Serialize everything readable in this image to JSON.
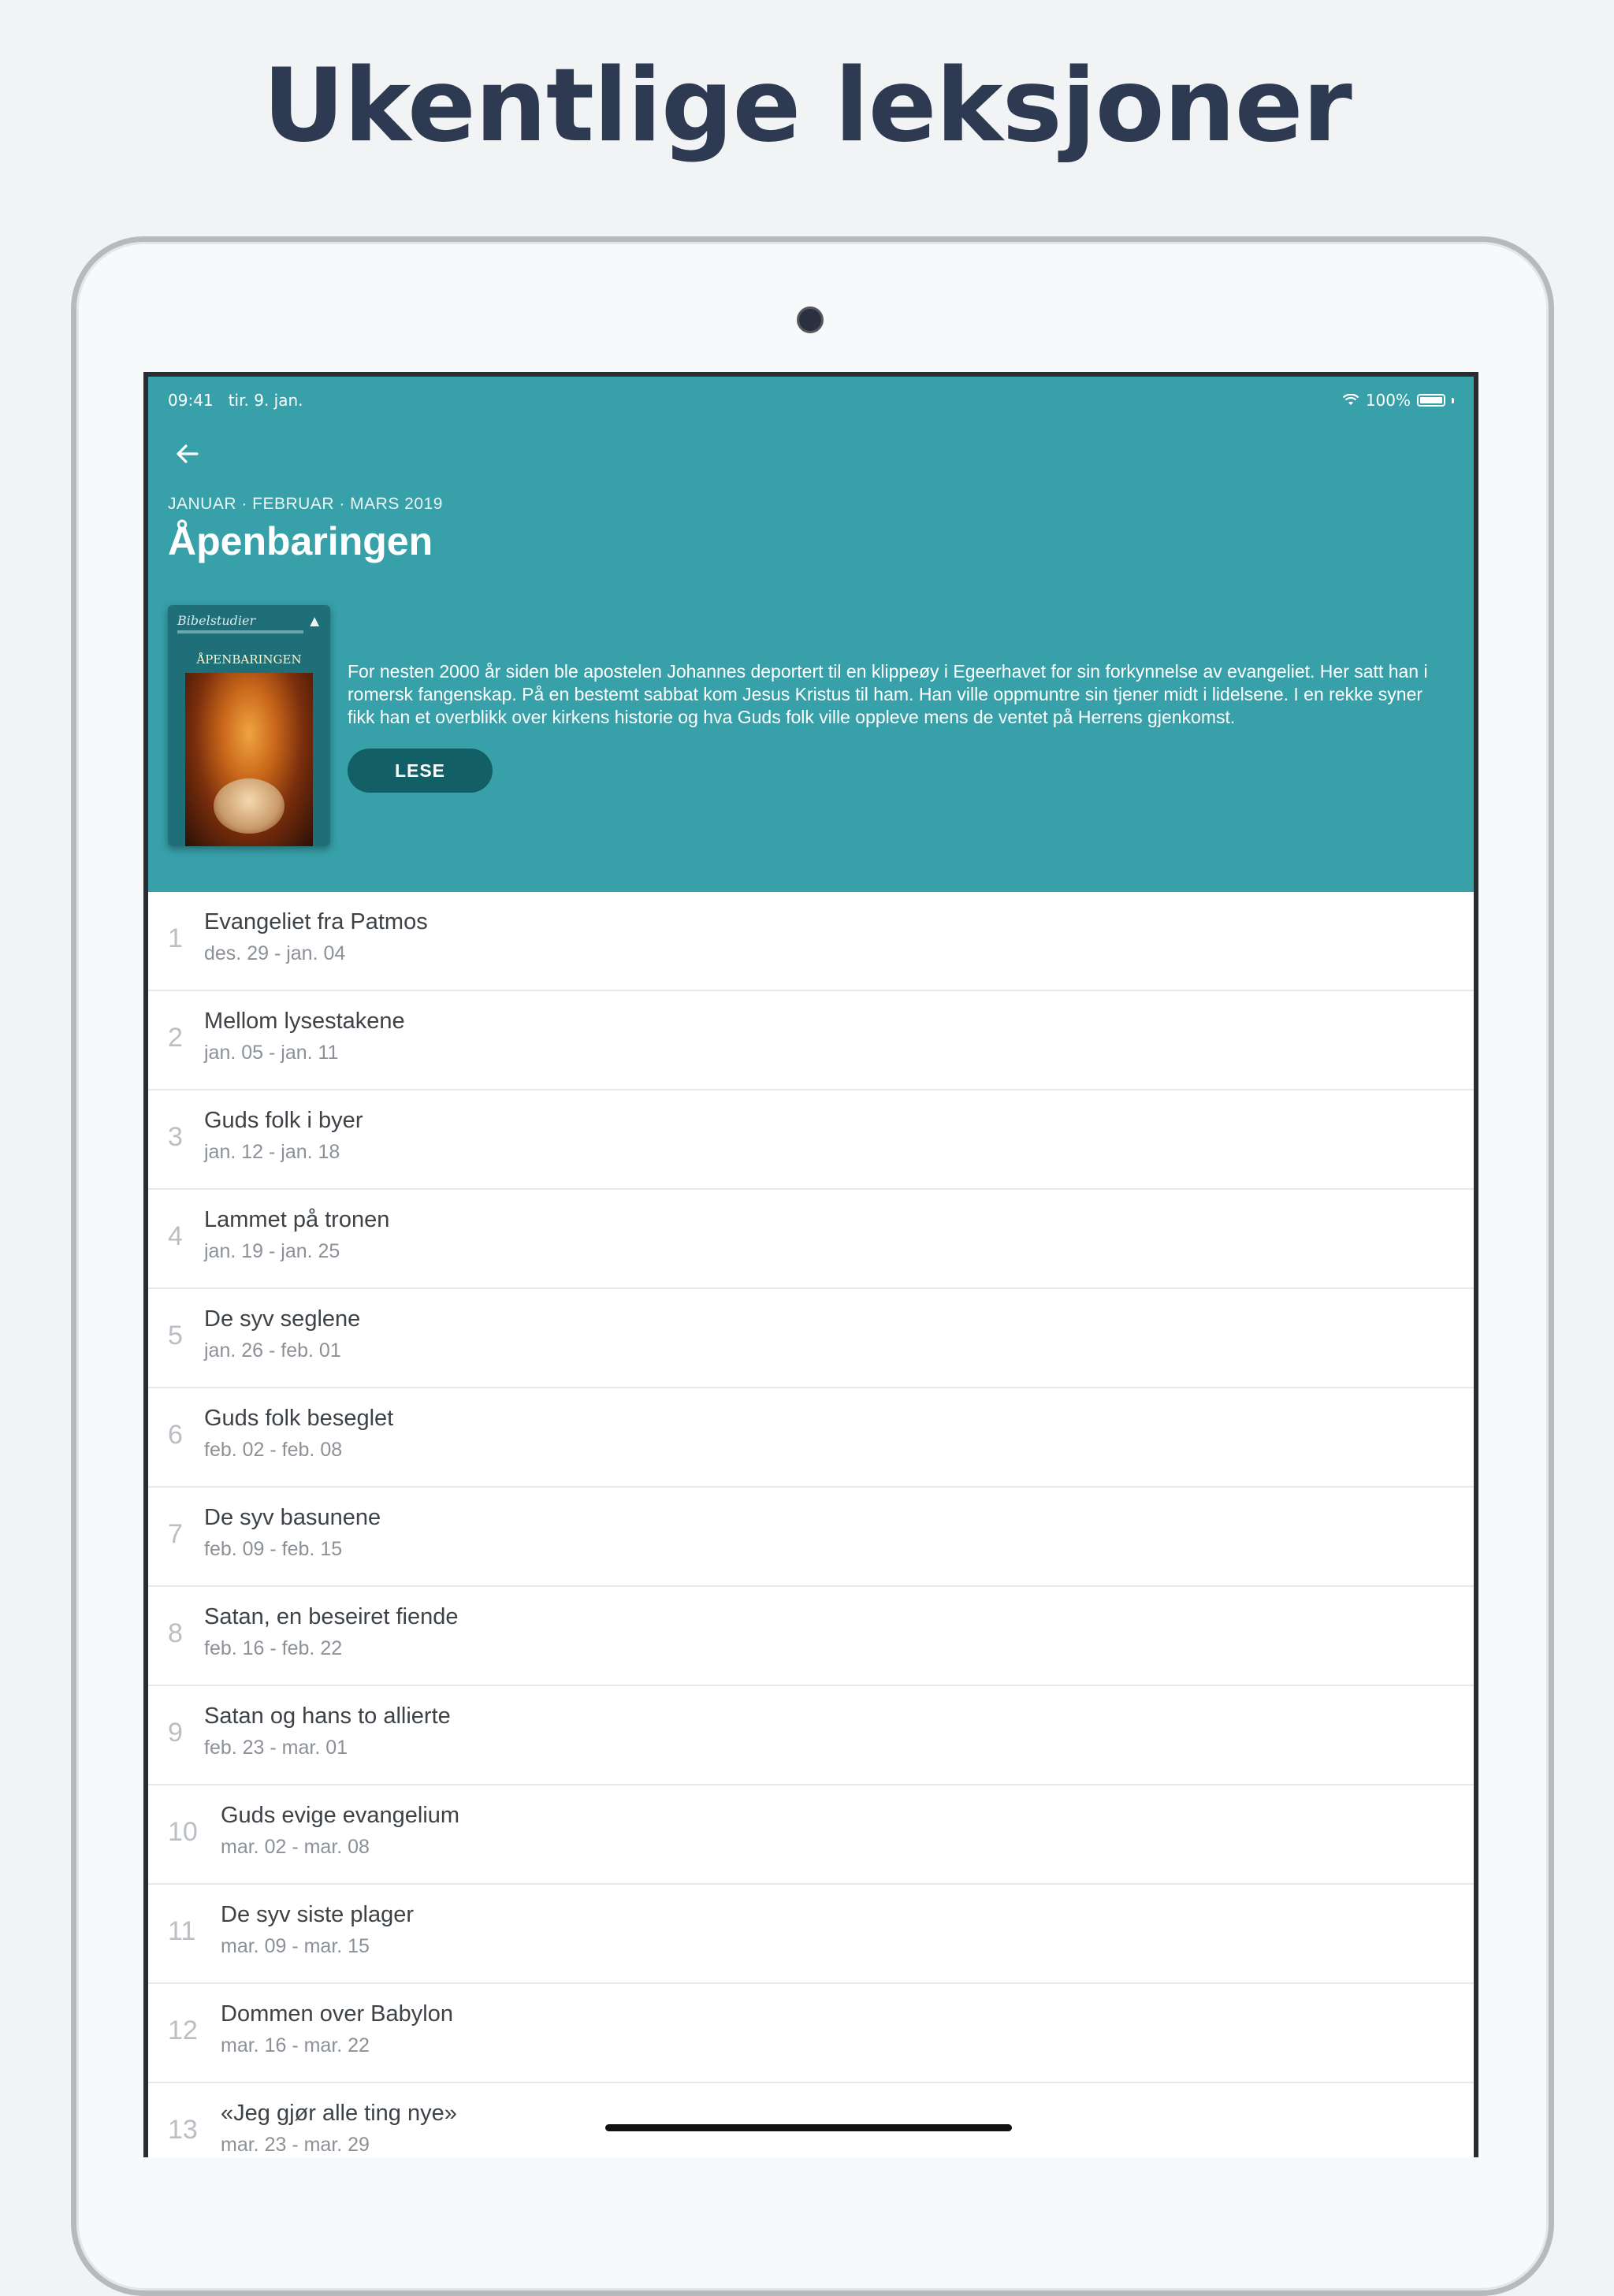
{
  "headline": "Ukentlige leksjoner",
  "status_bar": {
    "time": "09:41",
    "date": "tir. 9. jan.",
    "battery": "100%"
  },
  "quarterly": {
    "overline": "JANUAR · FEBRUAR · MARS 2019",
    "title": "Åpenbaringen",
    "cover": {
      "brand": "Bibelstudier",
      "label": "ÅPENBARINGEN"
    },
    "description": "For nesten 2000 år siden ble apostelen Johannes deportert til en klippeøy i Egeerhavet for sin forkynnelse av evangeliet. Her satt han i romersk fangenskap. På en bestemt sabbat kom Jesus Kristus til ham. Han ville oppmuntre sin tjener midt i lidelsene. I en rekke syner fikk han et overblikk over kirkens historie og hva Guds folk ville oppleve mens de ventet på Herrens gjenkomst.",
    "read_label": "LESE"
  },
  "lessons": [
    {
      "num": "1",
      "title": "Evangeliet fra Patmos",
      "dates": "des. 29 - jan. 04"
    },
    {
      "num": "2",
      "title": "Mellom lysestakene",
      "dates": "jan. 05 - jan. 11"
    },
    {
      "num": "3",
      "title": "Guds folk i byer",
      "dates": "jan. 12 - jan. 18"
    },
    {
      "num": "4",
      "title": "Lammet på tronen",
      "dates": "jan. 19 - jan. 25"
    },
    {
      "num": "5",
      "title": "De syv seglene",
      "dates": "jan. 26 - feb. 01"
    },
    {
      "num": "6",
      "title": "Guds folk beseglet",
      "dates": "feb. 02 - feb. 08"
    },
    {
      "num": "7",
      "title": "De syv basunene",
      "dates": "feb. 09 - feb. 15"
    },
    {
      "num": "8",
      "title": "Satan, en beseiret fiende",
      "dates": "feb. 16 - feb. 22"
    },
    {
      "num": "9",
      "title": "Satan og hans to allierte",
      "dates": "feb. 23 - mar. 01"
    },
    {
      "num": "10",
      "title": "Guds evige evangelium",
      "dates": "mar. 02 - mar. 08"
    },
    {
      "num": "11",
      "title": "De syv siste plager",
      "dates": "mar. 09 - mar. 15"
    },
    {
      "num": "12",
      "title": "Dommen over Babylon",
      "dates": "mar. 16 - mar. 22"
    },
    {
      "num": "13",
      "title": "«Jeg gjør alle ting nye»",
      "dates": "mar. 23 - mar. 29"
    }
  ],
  "icons": {
    "back": "arrow-left-icon",
    "wifi": "wifi-icon",
    "battery": "battery-icon"
  },
  "colors": {
    "header": "#37a0a9",
    "button": "#135f66",
    "headline": "#2d3a52"
  }
}
